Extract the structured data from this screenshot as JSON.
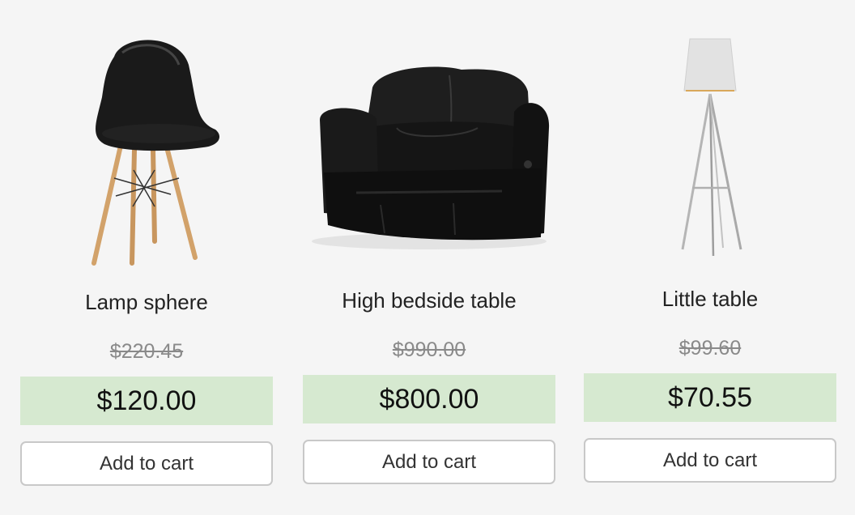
{
  "products": [
    {
      "name": "Lamp sphere",
      "old_price": "$220.45",
      "price": "$120.00",
      "button_label": "Add to cart"
    },
    {
      "name": "High bedside table",
      "old_price": "$990.00",
      "price": "$800.00",
      "button_label": "Add to cart"
    },
    {
      "name": "Little table",
      "old_price": "$99.60",
      "price": "$70.55",
      "button_label": "Add to cart"
    }
  ],
  "colors": {
    "background": "#f5f5f5",
    "price_highlight": "#d6e9d0",
    "button_border": "#c8c8c8",
    "old_price": "#8a8a8a"
  }
}
